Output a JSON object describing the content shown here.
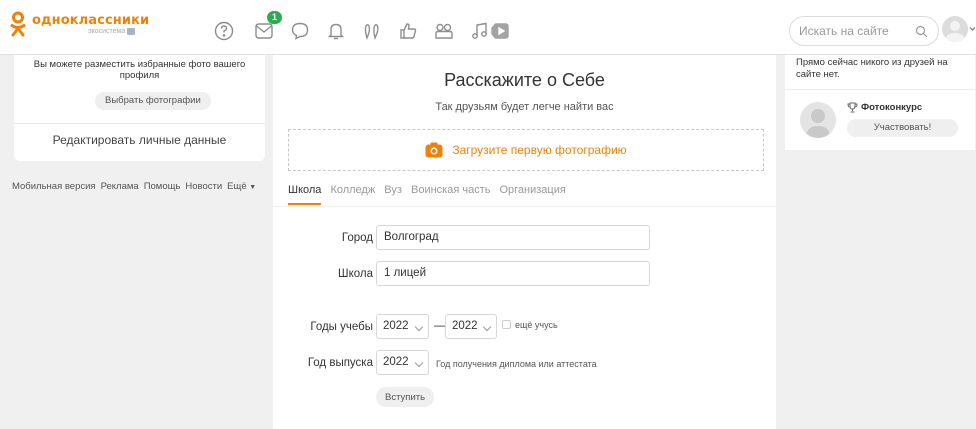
{
  "header": {
    "logo_title": "одноклассники",
    "logo_sub": "экосистема",
    "messages_badge": "1",
    "search_placeholder": "Искать на сайте"
  },
  "left": {
    "photo_hint": "Вы можете разместить избранные фото вашего профиля",
    "choose_photos": "Выбрать фотографии",
    "edit_personal": "Редактировать личные данные"
  },
  "footer": {
    "links": [
      "Мобильная версия",
      "Реклама",
      "Помощь",
      "Новости",
      "Ещё"
    ]
  },
  "center": {
    "title": "Расскажите о Себе",
    "subtitle": "Так друзьям будет легче найти вас",
    "upload_label": "Загрузите первую фотографию",
    "tabs": [
      {
        "label": "Школа",
        "active": true
      },
      {
        "label": "Колледж",
        "active": false
      },
      {
        "label": "Вуз",
        "active": false
      },
      {
        "label": "Воинская часть",
        "active": false
      },
      {
        "label": "Организация",
        "active": false
      }
    ],
    "form": {
      "city_label": "Город",
      "city_value": "Волгоград",
      "school_label": "Школа",
      "school_value": "1 лицей",
      "years_label": "Годы учебы",
      "year_from": "2022",
      "dash": "—",
      "year_to": "2022",
      "still_studying": "ещё учусь",
      "grad_label": "Год выпуска",
      "grad_year": "2022",
      "grad_hint": "Год получения диплома или аттестата",
      "join_button": "Вступить"
    }
  },
  "right": {
    "no_friends": "Прямо сейчас никого из друзей на сайте нет.",
    "contest_label": "Фотоконкурс",
    "participate_button": "Участвовать!"
  },
  "colors": {
    "accent": "#ee8208",
    "badge": "#2eab52"
  }
}
